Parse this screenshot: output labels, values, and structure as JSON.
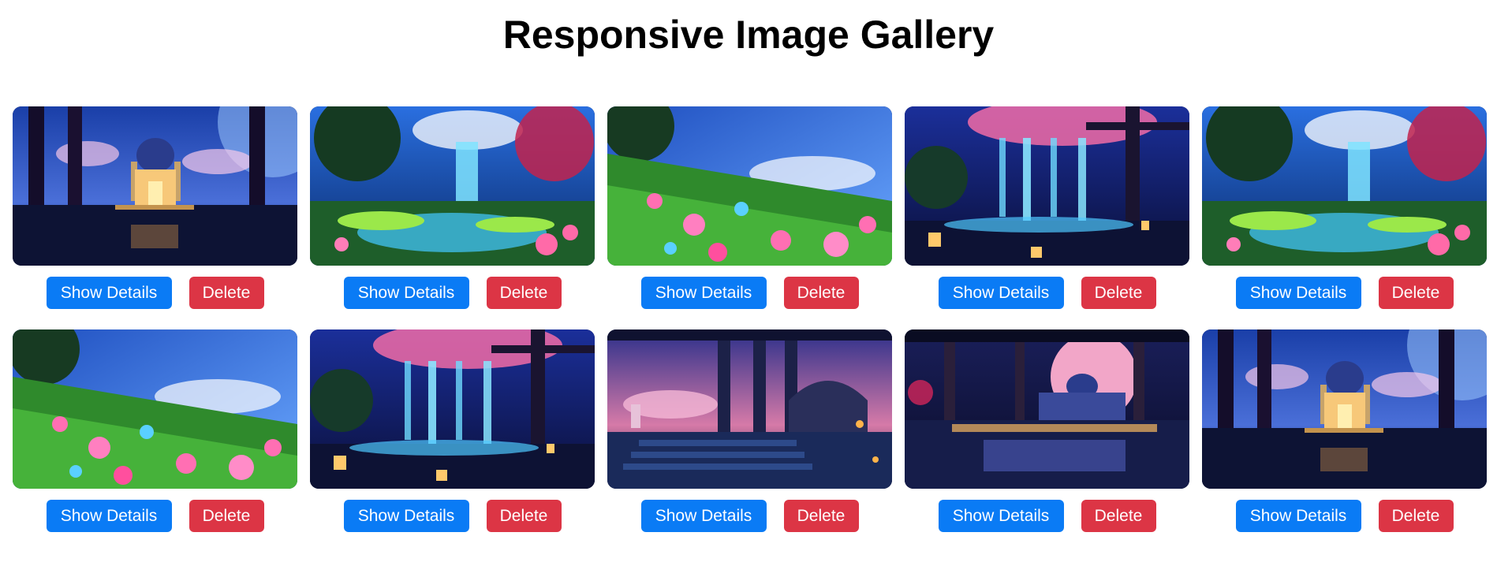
{
  "page": {
    "title": "Responsive Image Gallery"
  },
  "colors": {
    "details_button": "#0a7bf5",
    "delete_button": "#dc3545"
  },
  "gallery": {
    "items": [
      {
        "scene": "mosque-night",
        "details_label": "Show Details",
        "delete_label": "Delete"
      },
      {
        "scene": "waterfall-garden",
        "details_label": "Show Details",
        "delete_label": "Delete"
      },
      {
        "scene": "flower-meadow",
        "details_label": "Show Details",
        "delete_label": "Delete"
      },
      {
        "scene": "lantern-waterfall",
        "details_label": "Show Details",
        "delete_label": "Delete"
      },
      {
        "scene": "waterfall-garden",
        "details_label": "Show Details",
        "delete_label": "Delete"
      },
      {
        "scene": "flower-meadow",
        "details_label": "Show Details",
        "delete_label": "Delete"
      },
      {
        "scene": "lantern-waterfall",
        "details_label": "Show Details",
        "delete_label": "Delete"
      },
      {
        "scene": "palace-arches",
        "details_label": "Show Details",
        "delete_label": "Delete"
      },
      {
        "scene": "moon-palace",
        "details_label": "Show Details",
        "delete_label": "Delete"
      },
      {
        "scene": "mosque-night",
        "details_label": "Show Details",
        "delete_label": "Delete"
      }
    ]
  }
}
